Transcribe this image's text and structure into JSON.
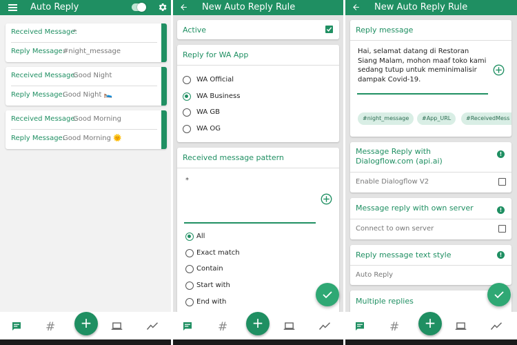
{
  "colors": {
    "primary": "#1f8f62",
    "accent": "#2fa874",
    "chip_bg": "#d9eee5"
  },
  "screen1": {
    "title": "Auto Reply",
    "icons": [
      "menu-icon",
      "toggle-switch",
      "gear-icon"
    ],
    "rules": [
      {
        "received_label": "Received Message:",
        "received_value": "*",
        "reply_label": "Reply Message:",
        "reply_value": "#night_message"
      },
      {
        "received_label": "Received Message:",
        "received_value": "Good Night",
        "reply_label": "Reply Message:",
        "reply_value": "Good Night 🛌"
      },
      {
        "received_label": "Received Message:",
        "received_value": "Good Morning",
        "reply_label": "Reply Message:",
        "reply_value": "Good Morning 🌞"
      }
    ]
  },
  "screen2": {
    "title": "New Auto Reply Rule",
    "active_label": "Active",
    "wa_section_title": "Reply for WA App",
    "wa_options": [
      "WA Official",
      "WA Business",
      "WA GB",
      "WA OG"
    ],
    "wa_selected": "WA Business",
    "pattern_title": "Received message pattern",
    "pattern_value": "*",
    "match_options": [
      "All",
      "Exact match",
      "Contain",
      "Start with",
      "End with"
    ],
    "match_selected": "All"
  },
  "screen3": {
    "title": "New Auto Reply Rule",
    "reply_title": "Reply message",
    "reply_text": "Hai, selamat datang di Restoran Siang Malam, mohon maaf toko kami sedang tutup untuk meminimalisir dampak Covid-19.",
    "chips": [
      "#night_message",
      "#App_URL",
      "#ReceivedMess"
    ],
    "dialogflow_title": "Message Reply with Dialogflow.com (api.ai)",
    "dialogflow_option": "Enable Dialogflow V2",
    "server_title": "Message reply with own server",
    "server_option": "Connect to own server",
    "style_title": "Reply message text style",
    "style_value": "Auto Reply",
    "multiple_title": "Multiple replies"
  },
  "bottom_nav": [
    "chat-icon",
    "hashtag-icon",
    "add-icon",
    "laptop-icon",
    "trending-icon"
  ]
}
